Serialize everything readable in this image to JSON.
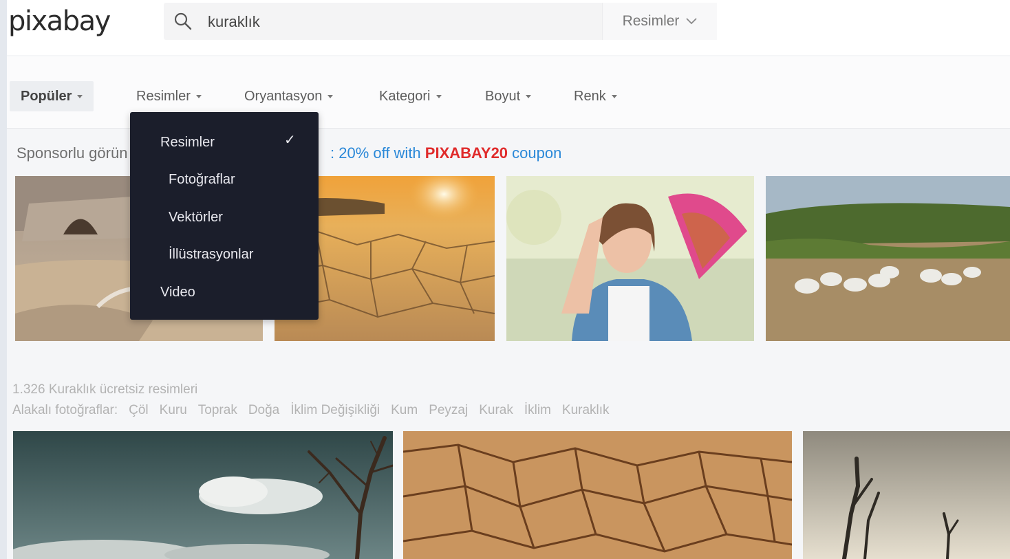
{
  "header": {
    "logo": "pixabay",
    "search_value": "kuraklık",
    "search_type": "Resimler"
  },
  "filters": [
    {
      "label": "Popüler",
      "active": true
    },
    {
      "label": "Resimler",
      "active": false
    },
    {
      "label": "Oryantasyon",
      "active": false
    },
    {
      "label": "Kategori",
      "active": false
    },
    {
      "label": "Boyut",
      "active": false
    },
    {
      "label": "Renk",
      "active": false
    }
  ],
  "dropdown": {
    "items": [
      "Resimler",
      "Fotoğraflar",
      "Vektörler",
      "İllüstrasyonlar",
      "Video"
    ],
    "checked": "Resimler"
  },
  "sponsored": {
    "label": "Sponsorlu görün",
    "coupon_prefix": ": 20% off with",
    "coupon_code": "PIXABAY20",
    "coupon_suffix": "coupon"
  },
  "results": {
    "count_text": "1.326 Kuraklık ücretsiz resimleri",
    "related_label": "Alakalı fotoğraflar:",
    "related_tags": [
      "Çöl",
      "Kuru",
      "Toprak",
      "Doğa",
      "İklim Değişikliği",
      "Kum",
      "Peyzaj",
      "Kurak",
      "İklim",
      "Kuraklık"
    ]
  },
  "colors": {
    "coupon_blue": "#2a88d8",
    "coupon_red": "#e02b2b",
    "dropdown_bg": "#1b1e2b"
  }
}
